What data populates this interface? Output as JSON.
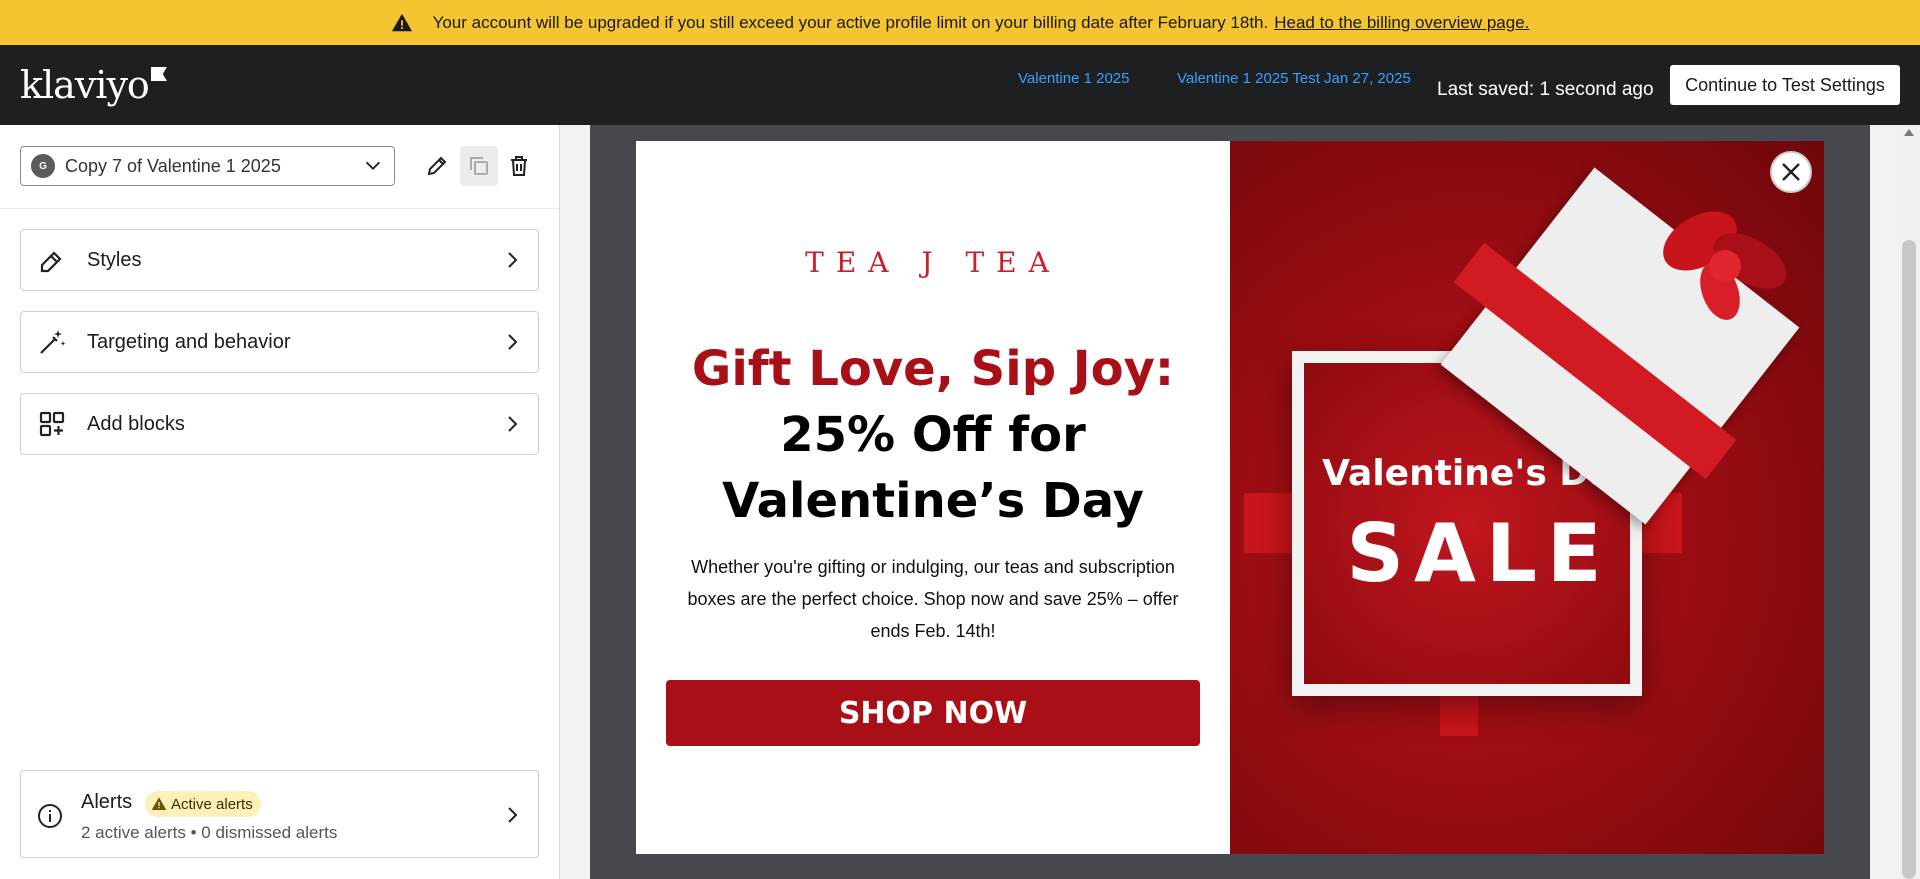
{
  "banner": {
    "message": "Your account will be upgraded if you still exceed your active profile limit on your billing date after February 18th.",
    "link": "Head to the billing overview page."
  },
  "header": {
    "logo": "klaviyo",
    "breadcrumbs": [
      "Valentine 1 2025",
      "Valentine 1 2025 Test Jan 27, 2025"
    ],
    "saved_status": "Last saved: 1 second ago",
    "continue_label": "Continue to Test Settings"
  },
  "sidebar": {
    "variant": {
      "avatar": "G",
      "name": "Copy 7 of Valentine 1 2025"
    },
    "items": [
      {
        "label": "Styles",
        "icon": "paintbrush-icon"
      },
      {
        "label": "Targeting and behavior",
        "icon": "magic-wand-icon"
      },
      {
        "label": "Add blocks",
        "icon": "add-blocks-icon"
      }
    ],
    "alerts": {
      "title": "Alerts",
      "badge": "Active alerts",
      "summary": "2 active alerts • 0 dismissed alerts"
    }
  },
  "popup": {
    "brand": "TEA J TEA",
    "headline_red": "Gift Love, Sip Joy:",
    "headline_line2": "25% Off for",
    "headline_line3": "Valentine’s Day",
    "body": "Whether you're gifting or indulging, our teas and subscription boxes are the perfect choice. Shop now and save 25% – offer ends Feb. 14th!",
    "button": "SHOP NOW",
    "image_title": "Valentine's Day",
    "image_sale": "SALE"
  },
  "colors": {
    "banner": "#f4c531",
    "topbar": "#1e1f21",
    "link": "#3aa0ff",
    "accent_red": "#a80f16"
  }
}
